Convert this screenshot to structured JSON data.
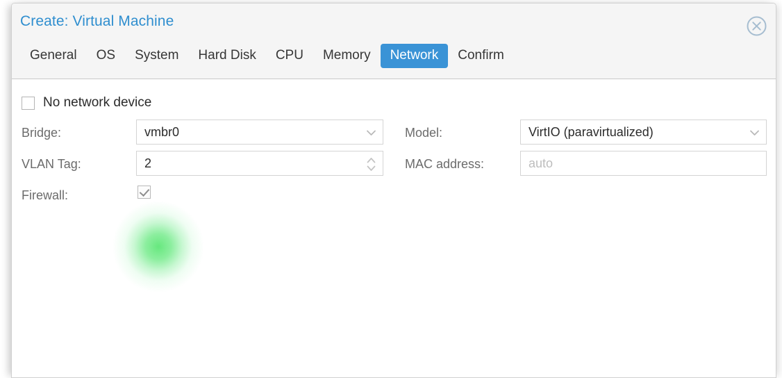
{
  "window": {
    "title": "Create: Virtual Machine",
    "close_icon": "close-circle-icon"
  },
  "tabs": [
    {
      "label": "General",
      "selected": false
    },
    {
      "label": "OS",
      "selected": false
    },
    {
      "label": "System",
      "selected": false
    },
    {
      "label": "Hard Disk",
      "selected": false
    },
    {
      "label": "CPU",
      "selected": false
    },
    {
      "label": "Memory",
      "selected": false
    },
    {
      "label": "Network",
      "selected": true
    },
    {
      "label": "Confirm",
      "selected": false
    }
  ],
  "form": {
    "no_network_device": {
      "label": "No network device",
      "checked": false
    },
    "bridge": {
      "label": "Bridge:",
      "value": "vmbr0",
      "icon": "chevron-down-icon"
    },
    "vlan_tag": {
      "label": "VLAN Tag:",
      "value": "2",
      "icon": "spinner-updown-icon",
      "highlighted": true
    },
    "firewall": {
      "label": "Firewall:",
      "checked": true
    },
    "model": {
      "label": "Model:",
      "value": "VirtIO (paravirtualized)",
      "icon": "chevron-down-icon"
    },
    "mac_address": {
      "label": "MAC address:",
      "value": "",
      "placeholder": "auto"
    }
  },
  "colors": {
    "accent": "#3a93d6",
    "title": "#2f8ecf",
    "header_bg": "#f5f5f5",
    "highlight": "#3ce15a"
  }
}
